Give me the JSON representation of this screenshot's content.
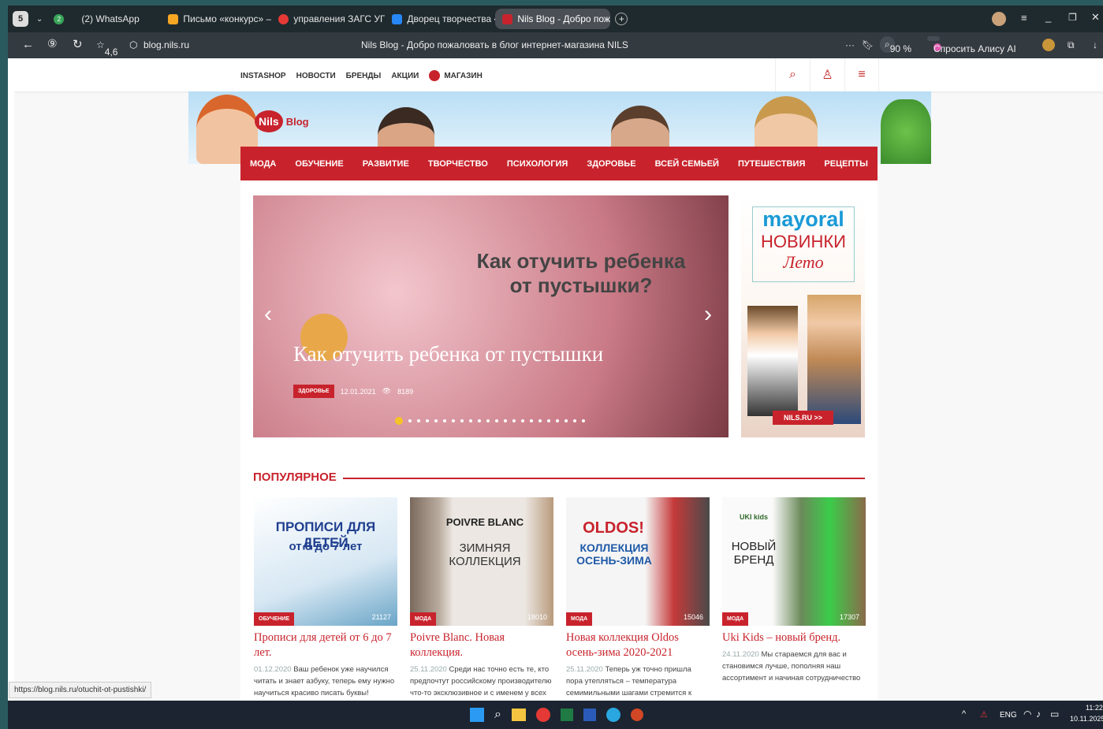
{
  "browser": {
    "tab_count_badge": "5",
    "tabs": [
      {
        "label": "2",
        "favicon": "#3aa65a"
      },
      {
        "label": "(2) WhatsApp",
        "favicon": "#25d366"
      },
      {
        "label": "Письмо «конкурс» — Ма",
        "favicon": "#f5a623"
      },
      {
        "label": "управления ЗАГС УГО —",
        "favicon": "#e53935"
      },
      {
        "label": "Дворец творчества «На",
        "favicon": "#2787f5"
      },
      {
        "label": "Nils Blog - Добро пожа",
        "favicon": "#c8232c"
      }
    ],
    "rating": "4,6",
    "url": "blog.nils.ru",
    "page_title": "Nils Blog - Добро пожаловать в блог интернет-магазина NILS",
    "zoom": "90 %",
    "alice": "Спросить Алису AI"
  },
  "site": {
    "top_links": [
      "INSTASHOP",
      "НОВОСТИ",
      "БРЕНДЫ",
      "АКЦИИ"
    ],
    "shop_link": "МАГАЗИН",
    "logo_nils": "Nils",
    "logo_blog": "Blog",
    "categories": [
      "МОДА",
      "ОБУЧЕНИЕ",
      "РАЗВИТИЕ",
      "ТВОРЧЕСТВО",
      "ПСИХОЛОГИЯ",
      "ЗДОРОВЬЕ",
      "ВСЕЙ СЕМЬЕЙ",
      "ПУТЕШЕСТВИЯ",
      "РЕЦЕПТЫ"
    ],
    "slider": {
      "image_heading_1": "Как отучить ребенка",
      "image_heading_2": "от пустышки?",
      "caption": "Как отучить ребенка от пустышки",
      "badge": "ЗДОРОВЬЕ",
      "date": "12.01.2021",
      "views": "8189",
      "dot_count": 22
    },
    "ad": {
      "brand": "mayoral",
      "line1": "НОВИНКИ",
      "line2": "Лето",
      "cta": "NILS.RU >>"
    },
    "popular_heading": "ПОПУЛЯРНОЕ",
    "cards": [
      {
        "img_line1": "ПРОПИСИ ДЛЯ ДЕТЕЙ",
        "img_line2": "от 6 до 7 лет",
        "badge": "ОБУЧЕНИЕ",
        "views": "21127",
        "title": "Прописи для детей от 6 до 7 лет.",
        "date": "01.12.2020",
        "excerpt": "Ваш ребенок уже научился читать и знает азбуку, теперь ему нужно научиться красиво писать буквы!"
      },
      {
        "img_line1": "POIVRE BLANC",
        "img_line2": "ЗИМНЯЯ КОЛЛЕКЦИЯ",
        "badge": "МОДА",
        "views": "18010",
        "title": "Poivre Blanc. Новая коллекция.",
        "date": "25.11.2020",
        "excerpt": "Среди нас точно есть те, кто предпочтут российскому производителю что-то эксклюзивное и с именем у всех"
      },
      {
        "img_line1": "OLDOS!",
        "img_line2": "КОЛЛЕКЦИЯ ОСЕНЬ-ЗИМА",
        "badge": "МОДА",
        "views": "15046",
        "title": "Новая коллекция Oldos осень-зима 2020-2021",
        "date": "25.11.2020",
        "excerpt": "Теперь уж точно пришла пора утепляться – температура семимильными шагами стремится к"
      },
      {
        "img_line1": "UKI kids",
        "img_line2": "НОВЫЙ БРЕНД",
        "badge": "МОДА",
        "views": "17307",
        "title": "Uki Kids – новый бренд.",
        "date": "24.11.2020",
        "excerpt": "Мы стараемся для вас и становимся лучше, пополняя наш ассортимент и начиная сотрудничество с"
      }
    ]
  },
  "status_url": "https://blog.nils.ru/otuchit-ot-pustishki/",
  "taskbar": {
    "lang": "ENG",
    "time": "11:22",
    "date": "10.11.2025"
  }
}
